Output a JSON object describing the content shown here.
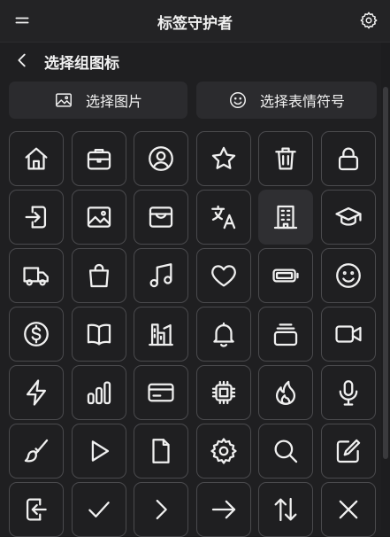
{
  "app": {
    "title": "标签守护者"
  },
  "header": {
    "subtitle": "选择组图标"
  },
  "buttons": {
    "select_image": "选择图片",
    "select_emoji": "选择表情符号"
  },
  "colors": {
    "background": "#1f1f21",
    "cell_border": "#4a4a4d",
    "button_bg": "#2b2b2e",
    "text": "#f0f0f0"
  },
  "icons": [
    "home-icon",
    "briefcase-icon",
    "user-circle-icon",
    "star-icon",
    "trash-icon",
    "lock-icon",
    "login-icon",
    "image-icon",
    "inbox-icon",
    "translate-icon",
    "building-icon",
    "graduation-cap-icon",
    "truck-icon",
    "shopping-bag-icon",
    "music-icon",
    "heart-icon",
    "battery-icon",
    "smile-icon",
    "dollar-icon",
    "book-open-icon",
    "chart-building-icon",
    "bell-icon",
    "archive-box-icon",
    "video-icon",
    "lightning-icon",
    "bar-chart-icon",
    "credit-card-icon",
    "cpu-chip-icon",
    "fire-icon",
    "microphone-icon",
    "brush-icon",
    "play-icon",
    "document-icon",
    "gear-icon",
    "search-icon",
    "edit-icon",
    "logout-icon",
    "check-icon",
    "chevron-right-icon",
    "arrow-right-icon",
    "arrows-up-down-icon",
    "x-icon"
  ],
  "selected_icon": "building-icon"
}
